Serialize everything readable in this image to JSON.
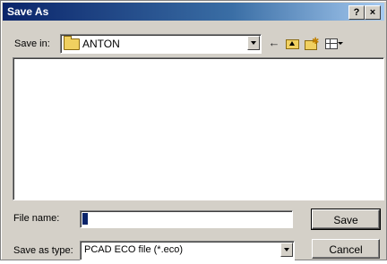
{
  "window": {
    "title": "Save As"
  },
  "titlebar": {
    "help_label": "?",
    "close_label": "×"
  },
  "toolbar": {
    "save_in_label": "Save in:",
    "save_in_value": "ANTON"
  },
  "filename": {
    "label": "File name:",
    "value": ""
  },
  "filetype": {
    "label": "Save as type:",
    "value": "PCAD ECO file (*.eco)"
  },
  "buttons": {
    "save": "Save",
    "cancel": "Cancel"
  },
  "icons": [
    "folder-icon",
    "back-arrow-icon",
    "up-one-level-icon",
    "new-folder-icon",
    "views-menu-icon",
    "help-icon",
    "close-icon"
  ],
  "colors": {
    "titlebar_start": "#0a246a",
    "titlebar_end": "#a6caf0",
    "face": "#d4d0c8"
  }
}
